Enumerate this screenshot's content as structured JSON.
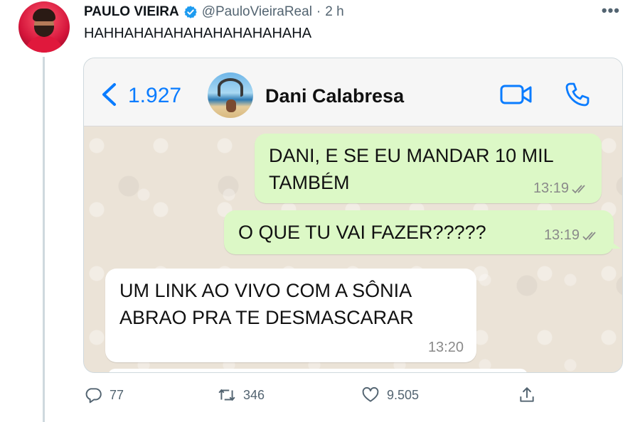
{
  "tweet": {
    "author_name": "PAULO VIEIRA",
    "handle": "@PauloVieiraReal",
    "separator": "·",
    "time": "2 h",
    "more": "•••",
    "text": "HAHHAHAHAHAHAHAHAHAHAHA",
    "replies": "77",
    "retweets": "346",
    "likes": "9.505"
  },
  "whatsapp": {
    "back_count": "1.927",
    "contact_name": "Dani Calabresa",
    "messages": [
      {
        "direction": "out",
        "lines": [
          "DANI, E SE EU MANDAR 10 MIL",
          "TAMBÉM"
        ],
        "time": "13:19"
      },
      {
        "direction": "out",
        "lines": [
          "O QUE TU VAI FAZER?????"
        ],
        "time": "13:19"
      },
      {
        "direction": "in",
        "lines": [
          "UM LINK AO VIVO COM A SÔNIA",
          "ABRAO PRA TE DESMASCARAR"
        ],
        "time": "13:20"
      }
    ]
  },
  "colors": {
    "verified": "#1d9bf0",
    "whatsapp_blue": "#0a7cff",
    "bubble_out": "#dcf8c6",
    "bubble_in": "#ffffff",
    "secondary_text": "#536471"
  },
  "icons": [
    "verified-badge-icon",
    "more-icon",
    "back-chevron-icon",
    "video-call-icon",
    "phone-call-icon",
    "read-ticks-icon",
    "reply-icon",
    "retweet-icon",
    "like-icon",
    "share-icon"
  ]
}
